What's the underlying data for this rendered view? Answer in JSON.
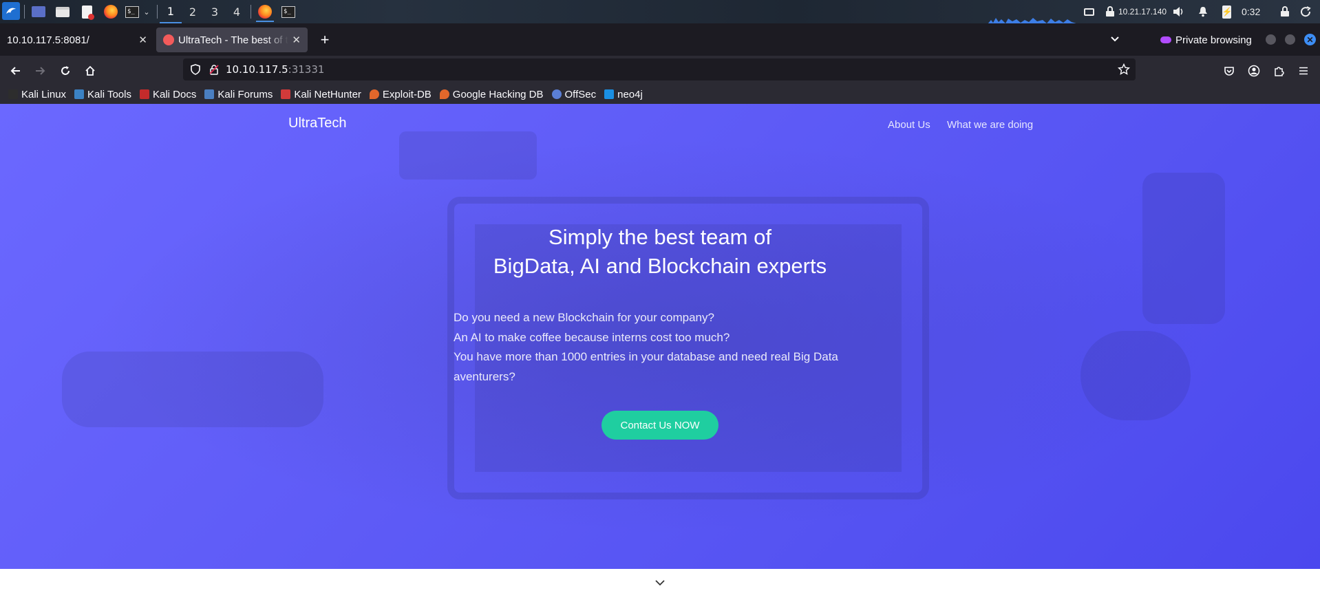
{
  "system_panel": {
    "workspaces": [
      "1",
      "2",
      "3",
      "4"
    ],
    "ip_address": "10.21.17.140",
    "clock": "0:32"
  },
  "browser": {
    "tabs": [
      {
        "title": "10.10.117.5:8081/"
      },
      {
        "title": "UltraTech - The best of tech"
      }
    ],
    "private_label": "Private browsing",
    "url_host": "10.10.117.5",
    "url_port": ":31331",
    "bookmarks": [
      {
        "label": "Kali Linux",
        "icon": "kali-dragon-icon",
        "color": "#2d2d2d"
      },
      {
        "label": "Kali Tools",
        "icon": "kali-tools-icon",
        "color": "#3b82c4"
      },
      {
        "label": "Kali Docs",
        "icon": "kali-docs-icon",
        "color": "#c42b2b"
      },
      {
        "label": "Kali Forums",
        "icon": "kali-forums-icon",
        "color": "#4a7fc1"
      },
      {
        "label": "Kali NetHunter",
        "icon": "nethunter-icon",
        "color": "#d23a3a"
      },
      {
        "label": "Exploit-DB",
        "icon": "exploit-db-icon",
        "color": "#e2672b"
      },
      {
        "label": "Google Hacking DB",
        "icon": "ghdb-icon",
        "color": "#e2672b"
      },
      {
        "label": "OffSec",
        "icon": "offsec-icon",
        "color": "#5b7fd6"
      },
      {
        "label": "neo4j",
        "icon": "neo4j-icon",
        "color": "#1a8fe3"
      }
    ]
  },
  "site": {
    "brand": "UltraTech",
    "nav": [
      "About Us",
      "What we are doing"
    ],
    "headline_line1": "Simply the best team of",
    "headline_line2": "BigData, AI and Blockchain experts",
    "intro_lines": [
      "Do you need a new Blockchain for your company?",
      "An AI to make coffee because interns cost too much?",
      "You have more than 1000 entries in your database and need real Big Data aventurers?"
    ],
    "cta_label": "Contact Us NOW"
  },
  "colors": {
    "hero_accent": "#5f5cf7",
    "cta": "#1fcea0",
    "private_icon": "#b14cff"
  }
}
